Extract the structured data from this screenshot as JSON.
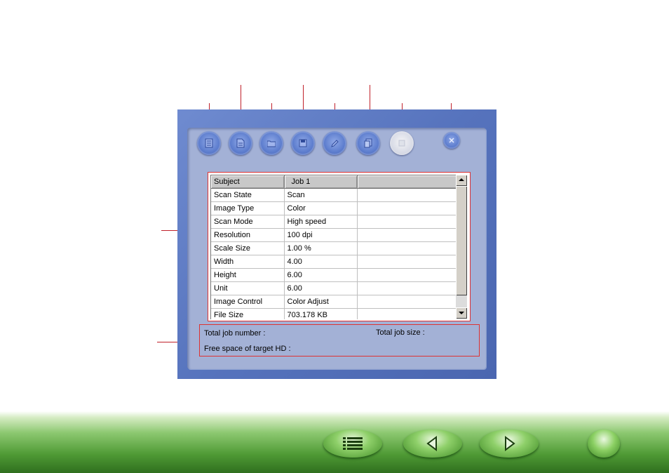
{
  "toolbar": {
    "buttons": [
      {
        "icon": "job-list-icon"
      },
      {
        "icon": "job-page-icon"
      },
      {
        "icon": "open-folder-icon"
      },
      {
        "icon": "save-icon"
      },
      {
        "icon": "edit-pencil-icon"
      },
      {
        "icon": "copy-icon"
      },
      {
        "icon": "stop-icon",
        "state": "disabled"
      },
      {
        "icon": "close-icon"
      }
    ]
  },
  "table": {
    "headers": [
      "Subject",
      "Job 1",
      ""
    ],
    "rows": [
      [
        "Scan State",
        "Scan"
      ],
      [
        "Image Type",
        "Color"
      ],
      [
        "Scan Mode",
        "High speed"
      ],
      [
        "Resolution",
        "100 dpi"
      ],
      [
        "Scale Size",
        "1.00 %"
      ],
      [
        "Width",
        "4.00"
      ],
      [
        "Height",
        "6.00"
      ],
      [
        "Unit",
        "6.00"
      ],
      [
        "Image Control",
        "Color Adjust"
      ],
      [
        "File Size",
        "703.178 KB"
      ]
    ]
  },
  "status": {
    "total_job_number": "Total job number :",
    "total_job_size": "Total job size :",
    "free_space": "Free space of target HD :"
  },
  "navigation": {
    "buttons": [
      "contents-menu-icon",
      "previous-page-icon",
      "next-page-icon",
      "home-icon"
    ]
  },
  "colors": {
    "callout": "#c0202a",
    "panel": "#5673bd",
    "panel_inner": "#a3b1d6",
    "nav_green": "#4f9a35"
  }
}
